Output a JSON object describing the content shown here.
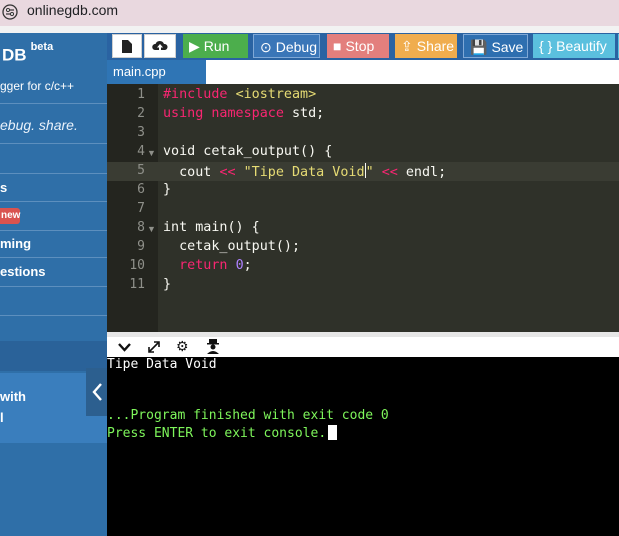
{
  "browser": {
    "url": "onlinegdb.com"
  },
  "sidebar": {
    "brand": "DB",
    "brand_badge": "beta",
    "brand_subtitle": "gger for c/c++",
    "tagline": "ebug. share.",
    "items": [
      {
        "label": "s"
      },
      {
        "label": "new"
      },
      {
        "label": "ming"
      },
      {
        "label": "estions"
      }
    ],
    "panel_lines": [
      "with",
      "l"
    ],
    "collapse_icon": "chevron-left-icon"
  },
  "toolbar": {
    "run_label": "Run",
    "debug_label": "Debug",
    "stop_label": "Stop",
    "share_label": "Share",
    "save_label": "Save",
    "beautify_label": "{ } Beautify"
  },
  "tabs": [
    {
      "label": "main.cpp",
      "active": true
    }
  ],
  "editor": {
    "active_line": 5,
    "line_numbers": [
      "1",
      "2",
      "3",
      "4",
      "5",
      "6",
      "7",
      "8",
      "9",
      "10",
      "11"
    ],
    "lines": [
      "#include <iostream>",
      "using namespace std;",
      "",
      "void cetak_output() {",
      "  cout << \"Tipe Data Void\" << endl;",
      "}",
      "",
      "int main() {",
      "  cetak_output();",
      "  return 0;",
      "}"
    ]
  },
  "console": {
    "output_lines": [
      "Tipe Data Void",
      "",
      "",
      "...Program finished with exit code 0",
      "Press ENTER to exit console."
    ]
  },
  "colors": {
    "sidebar": "#2f6fa8",
    "run": "#4cae4c",
    "stop": "#e37f7d",
    "share": "#f0ad4e",
    "beautify": "#5bc0de",
    "editor_bg": "#2f3129",
    "console_green": "#7ef55b"
  }
}
